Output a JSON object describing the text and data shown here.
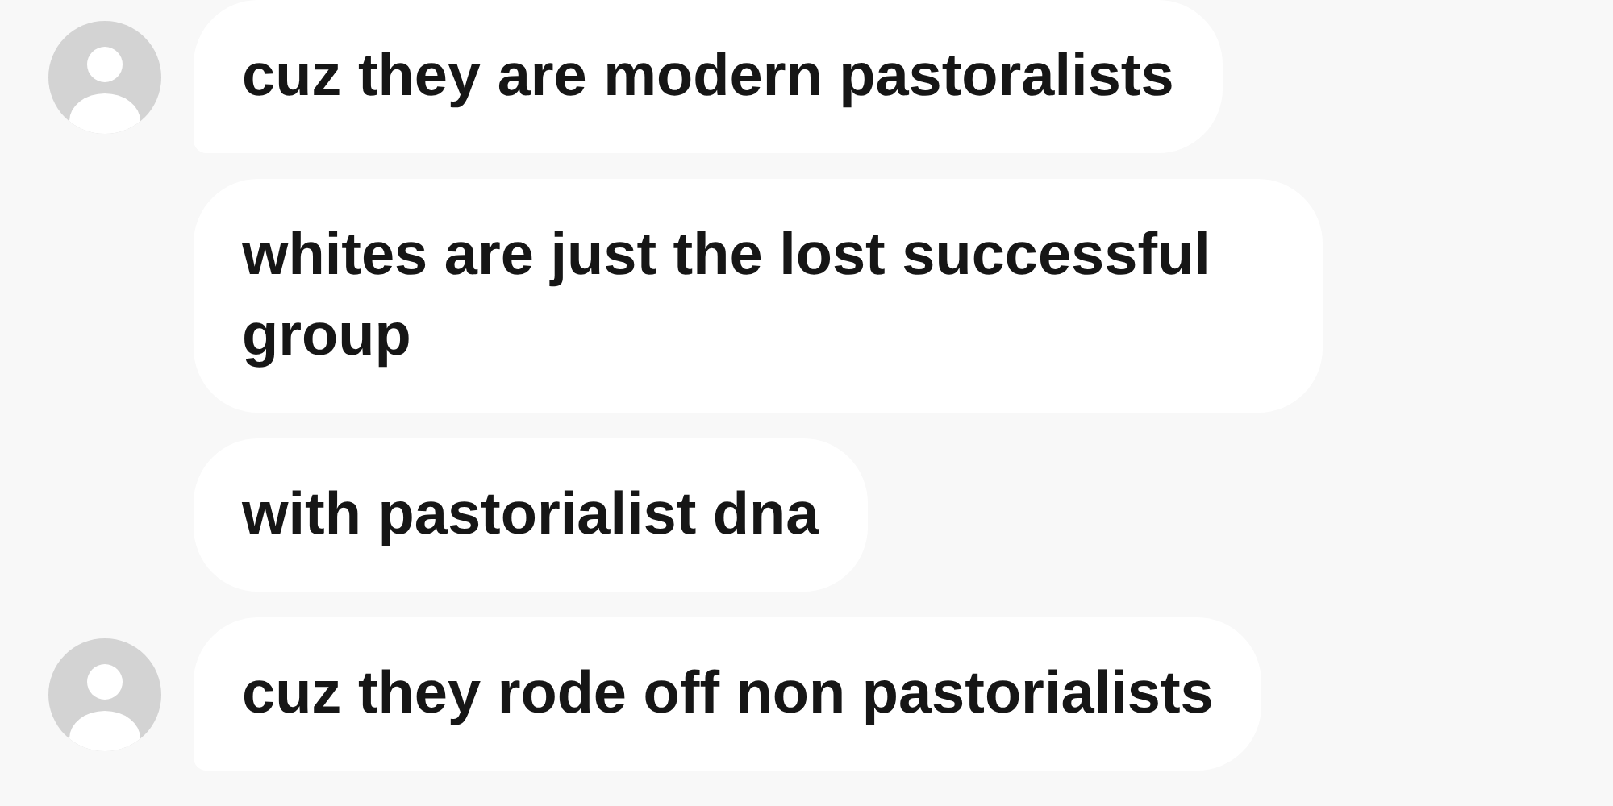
{
  "messages": [
    {
      "text": "cuz they are modern pastoralists",
      "avatar": true
    },
    {
      "text": "whites are just the lost successful group",
      "avatar": false
    },
    {
      "text": "with pastorialist dna",
      "avatar": false
    },
    {
      "text": "cuz they rode off non pastorialists",
      "avatar": true
    }
  ]
}
